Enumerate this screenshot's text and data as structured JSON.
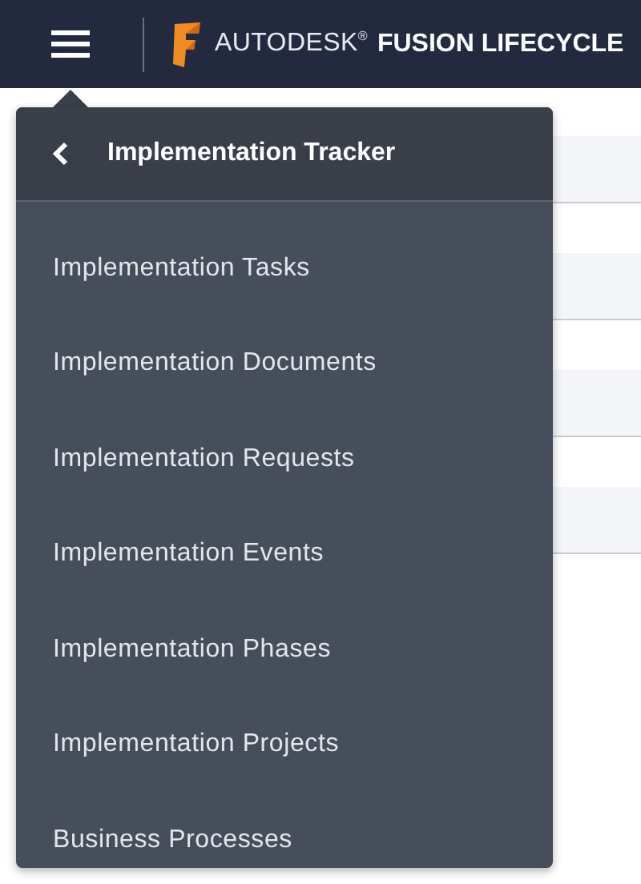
{
  "header": {
    "brand": "AUTODESK$^{®}$",
    "product": "FUSION LIFECYCLE"
  },
  "menu": {
    "title": "Implementation Tracker",
    "items": [
      {
        "label": "Implementation Tasks"
      },
      {
        "label": "Implementation Documents"
      },
      {
        "label": "Implementation Requests"
      },
      {
        "label": "Implementation Events"
      },
      {
        "label": "Implementation Phases"
      },
      {
        "label": "Implementation Projects"
      },
      {
        "label": "Business Processes"
      }
    ]
  }
}
